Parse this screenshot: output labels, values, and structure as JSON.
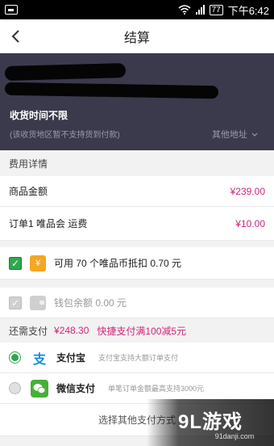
{
  "statusbar": {
    "battery": "77",
    "time": "下午6:42"
  },
  "header": {
    "title": "结算"
  },
  "address": {
    "delivery_time": "收货时间不限",
    "note": "(该收货地区暂不支持货到付款)",
    "other": "其他地址"
  },
  "fees": {
    "section_title": "费用详情",
    "goods_label": "商品金额",
    "goods_value": "¥239.00",
    "shipping_label": "订单1 唯品会 运费",
    "shipping_value": "¥10.00"
  },
  "vip_coin": {
    "label": "可用 70 个唯品币抵扣 0.70 元",
    "coin_glyph": "¥",
    "checked": true
  },
  "wallet": {
    "label": "钱包余额 0.00 元",
    "checked": false
  },
  "payment": {
    "remaining_label": "还需支付",
    "remaining_value": "¥248.30",
    "promo": "快捷支付满100减5元",
    "methods": [
      {
        "name": "支付宝",
        "desc": "支付宝支持大额订单支付",
        "selected": true
      },
      {
        "name": "微信支付",
        "desc": "单笔订单金额最高支持3000元",
        "selected": false
      }
    ],
    "other_methods": "选择其他支付方式"
  },
  "watermark": {
    "logo": "9L游戏",
    "url": "91danji.com"
  },
  "colors": {
    "accent": "#d4237a",
    "green": "#2fa84f",
    "header_bg": "#3a3a4c"
  }
}
